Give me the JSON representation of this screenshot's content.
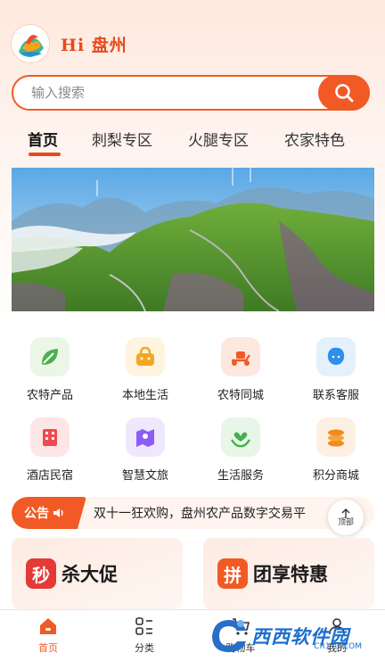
{
  "header": {
    "greeting": "Hi 盘州",
    "logo_icon": "panzhou-logo-icon"
  },
  "search": {
    "placeholder": "输入搜索",
    "value": "",
    "button_icon": "search-icon"
  },
  "tabs": [
    {
      "label": "首页",
      "active": true
    },
    {
      "label": "刺梨专区",
      "active": false
    },
    {
      "label": "火腿专区",
      "active": false
    },
    {
      "label": "农家特色",
      "active": false
    }
  ],
  "banner": {
    "image": "mountain-landscape-banner"
  },
  "services": [
    {
      "label": "农特产品",
      "icon": "leaf-icon",
      "color": "#4caf50"
    },
    {
      "label": "本地生活",
      "icon": "shopping-basket-icon",
      "color": "#f5a623"
    },
    {
      "label": "农特同城",
      "icon": "scooter-icon",
      "color": "#f15a24"
    },
    {
      "label": "联系客服",
      "icon": "headset-icon",
      "color": "#2f8fe8"
    },
    {
      "label": "酒店民宿",
      "icon": "hotel-icon",
      "color": "#ef4b52"
    },
    {
      "label": "智慧文旅",
      "icon": "map-pin-icon",
      "color": "#8b5cf6"
    },
    {
      "label": "生活服务",
      "icon": "heart-hands-icon",
      "color": "#43b04a"
    },
    {
      "label": "积分商城",
      "icon": "coins-icon",
      "color": "#f28b1e"
    }
  ],
  "notice": {
    "badge": "公告",
    "text": "双十一狂欢购，盘州农产品数字交易平",
    "top_button": "顶部"
  },
  "promos": [
    {
      "badge": "秒",
      "title": "杀大促",
      "color": "#e53935"
    },
    {
      "badge": "拼",
      "title": "团享特惠",
      "color": "#f15a24"
    }
  ],
  "tabbar": [
    {
      "label": "首页",
      "icon": "home-icon",
      "active": true
    },
    {
      "label": "分类",
      "icon": "category-icon",
      "active": false
    },
    {
      "label": "购物车",
      "icon": "cart-icon",
      "active": false
    },
    {
      "label": "我的",
      "icon": "user-icon",
      "active": false
    }
  ],
  "watermark": {
    "text": "西西软件园",
    "sub": "CR173.COM"
  },
  "colors": {
    "accent": "#f15a24",
    "active_text": "#e74a1b"
  }
}
